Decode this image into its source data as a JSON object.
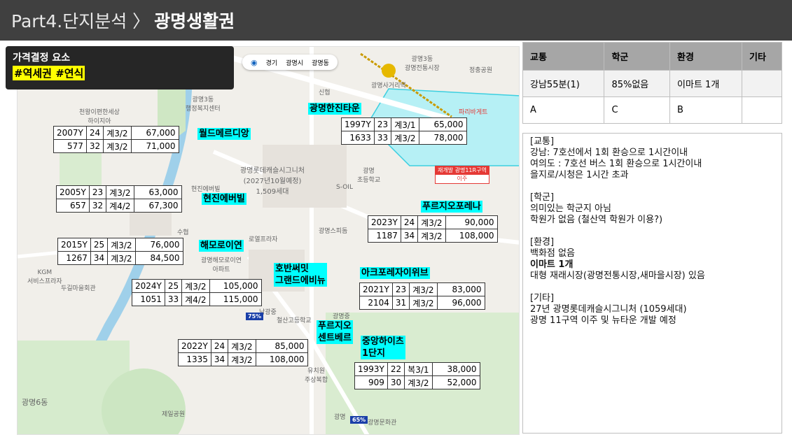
{
  "header": {
    "part": "Part4.단지분석 〉",
    "title": "광명생활권"
  },
  "price_factor": {
    "title": "가격결정 요소",
    "tags": "#역세권 #연식"
  },
  "map_tabs": {
    "loc_icon": "location-icon",
    "items": [
      "경기",
      "광명시",
      "광명동"
    ]
  },
  "complexes": [
    {
      "name": "월드메르디앙",
      "rows": [
        [
          "2007Y",
          "24",
          "계3/2",
          "67,000"
        ],
        [
          "577",
          "32",
          "계3/2",
          "71,000"
        ]
      ]
    },
    {
      "name": "광명한진타운",
      "rows": [
        [
          "1997Y",
          "23",
          "계3/1",
          "65,000"
        ],
        [
          "1633",
          "33",
          "계3/2",
          "78,000"
        ]
      ]
    },
    {
      "name": "현진에버빌",
      "rows": [
        [
          "2005Y",
          "23",
          "계3/2",
          "63,000"
        ],
        [
          "657",
          "32",
          "계4/2",
          "67,300"
        ]
      ]
    },
    {
      "name": "푸르지오포레나",
      "rows": [
        [
          "2023Y",
          "24",
          "계3/2",
          "90,000"
        ],
        [
          "1187",
          "34",
          "계3/2",
          "108,000"
        ]
      ]
    },
    {
      "name": "해모로이연",
      "rows": [
        [
          "2015Y",
          "25",
          "계3/2",
          "76,000"
        ],
        [
          "1267",
          "34",
          "계3/2",
          "84,500"
        ]
      ]
    },
    {
      "name": "호반써밋\n그랜드에비뉴",
      "rows": [
        [
          "2024Y",
          "25",
          "계3/2",
          "105,000"
        ],
        [
          "1051",
          "33",
          "계4/2",
          "115,000"
        ]
      ]
    },
    {
      "name": "아크포레자이위브",
      "rows": [
        [
          "2021Y",
          "23",
          "계3/2",
          "83,000"
        ],
        [
          "2104",
          "31",
          "계3/2",
          "96,000"
        ]
      ]
    },
    {
      "name": "푸르지오\n센트베르",
      "rows": [
        [
          "2022Y",
          "24",
          "계3/2",
          "85,000"
        ],
        [
          "1335",
          "34",
          "계3/2",
          "108,000"
        ]
      ]
    },
    {
      "name": "중앙하이츠\n1단지",
      "rows": [
        [
          "1993Y",
          "22",
          "복3/1",
          "38,000"
        ],
        [
          "909",
          "30",
          "계3/2",
          "52,000"
        ]
      ]
    }
  ],
  "map_labels": {
    "l1": "광명3동\n광명전통시장",
    "l2": "광명사거리역",
    "l3": "광명3동\n행정복지센터",
    "l4": "천왕이편한세상\n하이지아",
    "l5": "광명롯데캐슬시그니처\n(2027년10월예정)\n1,509세대",
    "l6": "광명\n초등학교",
    "l7": "S-OIL",
    "l8": "KGM\n서비스프라자",
    "l9": "두길마을회관",
    "l10": "광명6동",
    "l11": "남광중",
    "l12": "철산고등학교",
    "l13": "신협",
    "l14": "정충공원",
    "l15": "파리바게트",
    "l16": "현진에버빌",
    "l17": "로열프라자",
    "l18": "광명해모로이연\n아파트",
    "l19": "수협",
    "l20": "제일공원",
    "l21": "광명스피돔",
    "l22": "광명중",
    "l23": "광명문화관",
    "l24": "유치원\n주상복합",
    "l25": "광명"
  },
  "red_badge": {
    "top": "재개발 광명11R구역",
    "bottom": "이주"
  },
  "pins": [
    "75%",
    "65%"
  ],
  "info_table": {
    "headers": [
      "교통",
      "학군",
      "환경",
      "기타"
    ],
    "row1": [
      "강남55분(1)",
      "85%없음",
      "이마트 1개",
      ""
    ],
    "row2": [
      "A",
      "C",
      "B",
      ""
    ]
  },
  "notes": {
    "transport_h": "[교통]",
    "transport_1": "강남: 7호선에서 1회 환승으로 1시간이내",
    "transport_2": "여의도 : 7호선 버스 1회 환승으로 1시간이내",
    "transport_3": "을지로/시청은 1시간 초과",
    "school_h": "[학군]",
    "school_1": "의미있는 학군지 아님",
    "school_2": "학원가 없음 (철산역 학원가 이용?)",
    "env_h": "[환경]",
    "env_1": "백화점 없음",
    "env_2": "이마트 1개",
    "env_3": "대형 재래시장(광명전통시장,새마을시장) 있음",
    "etc_h": "[기타]",
    "etc_1": "27년 광명롯데캐슬시그니처 (1059세대)",
    "etc_2": "광명 11구역 이주 및 뉴타운 개발 예정"
  }
}
